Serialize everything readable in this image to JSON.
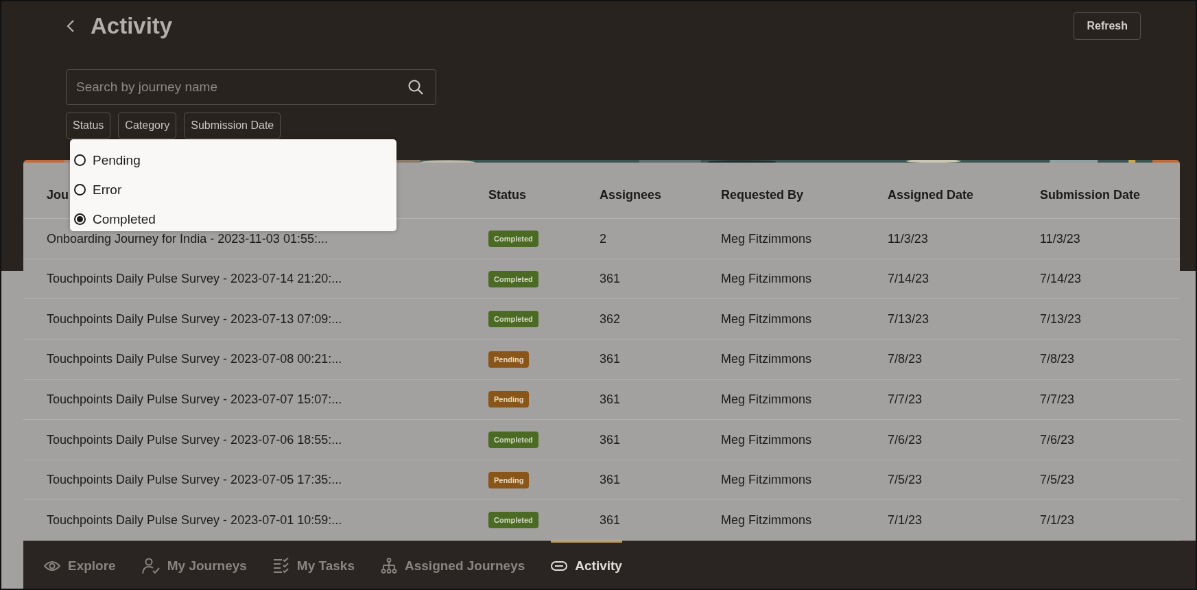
{
  "header": {
    "title": "Activity",
    "refresh": "Refresh"
  },
  "search": {
    "placeholder": "Search by journey name"
  },
  "filters": [
    "Status",
    "Category",
    "Submission Date"
  ],
  "status_menu": [
    {
      "label": "Pending",
      "selected": false
    },
    {
      "label": "Error",
      "selected": false
    },
    {
      "label": "Completed",
      "selected": true
    }
  ],
  "table": {
    "columns": [
      "Jou",
      "Status",
      "Assignees",
      "Requested By",
      "Assigned Date",
      "Submission Date"
    ],
    "rows": [
      {
        "journey": "Onboarding Journey for India - 2023-11-03 01:55:...",
        "status": {
          "label": "Completed",
          "kind": "completed"
        },
        "assignees": "2",
        "requested_by": "Meg Fitzimmons",
        "assigned_date": "11/3/23",
        "submission_date": "11/3/23"
      },
      {
        "journey": "Touchpoints Daily Pulse Survey - 2023-07-14 21:20:...",
        "status": {
          "label": "Completed",
          "kind": "completed"
        },
        "assignees": "361",
        "requested_by": "Meg Fitzimmons",
        "assigned_date": "7/14/23",
        "submission_date": "7/14/23"
      },
      {
        "journey": "Touchpoints Daily Pulse Survey - 2023-07-13 07:09:...",
        "status": {
          "label": "Completed",
          "kind": "completed"
        },
        "assignees": "362",
        "requested_by": "Meg Fitzimmons",
        "assigned_date": "7/13/23",
        "submission_date": "7/13/23"
      },
      {
        "journey": "Touchpoints Daily Pulse Survey - 2023-07-08 00:21:...",
        "status": {
          "label": "Pending",
          "kind": "pending"
        },
        "assignees": "361",
        "requested_by": "Meg Fitzimmons",
        "assigned_date": "7/8/23",
        "submission_date": "7/8/23"
      },
      {
        "journey": "Touchpoints Daily Pulse Survey - 2023-07-07 15:07:...",
        "status": {
          "label": "Pending",
          "kind": "pending"
        },
        "assignees": "361",
        "requested_by": "Meg Fitzimmons",
        "assigned_date": "7/7/23",
        "submission_date": "7/7/23"
      },
      {
        "journey": "Touchpoints Daily Pulse Survey - 2023-07-06 18:55:...",
        "status": {
          "label": "Completed",
          "kind": "completed"
        },
        "assignees": "361",
        "requested_by": "Meg Fitzimmons",
        "assigned_date": "7/6/23",
        "submission_date": "7/6/23"
      },
      {
        "journey": "Touchpoints Daily Pulse Survey - 2023-07-05 17:35:...",
        "status": {
          "label": "Pending",
          "kind": "pending"
        },
        "assignees": "361",
        "requested_by": "Meg Fitzimmons",
        "assigned_date": "7/5/23",
        "submission_date": "7/5/23"
      },
      {
        "journey": "Touchpoints Daily Pulse Survey - 2023-07-01 10:59:...",
        "status": {
          "label": "Completed",
          "kind": "completed"
        },
        "assignees": "361",
        "requested_by": "Meg Fitzimmons",
        "assigned_date": "7/1/23",
        "submission_date": "7/1/23"
      }
    ]
  },
  "nav": [
    {
      "label": "Explore",
      "selected": false
    },
    {
      "label": "My Journeys",
      "selected": false
    },
    {
      "label": "My Tasks",
      "selected": false
    },
    {
      "label": "Assigned Journeys",
      "selected": false
    },
    {
      "label": "Activity",
      "selected": true
    }
  ]
}
